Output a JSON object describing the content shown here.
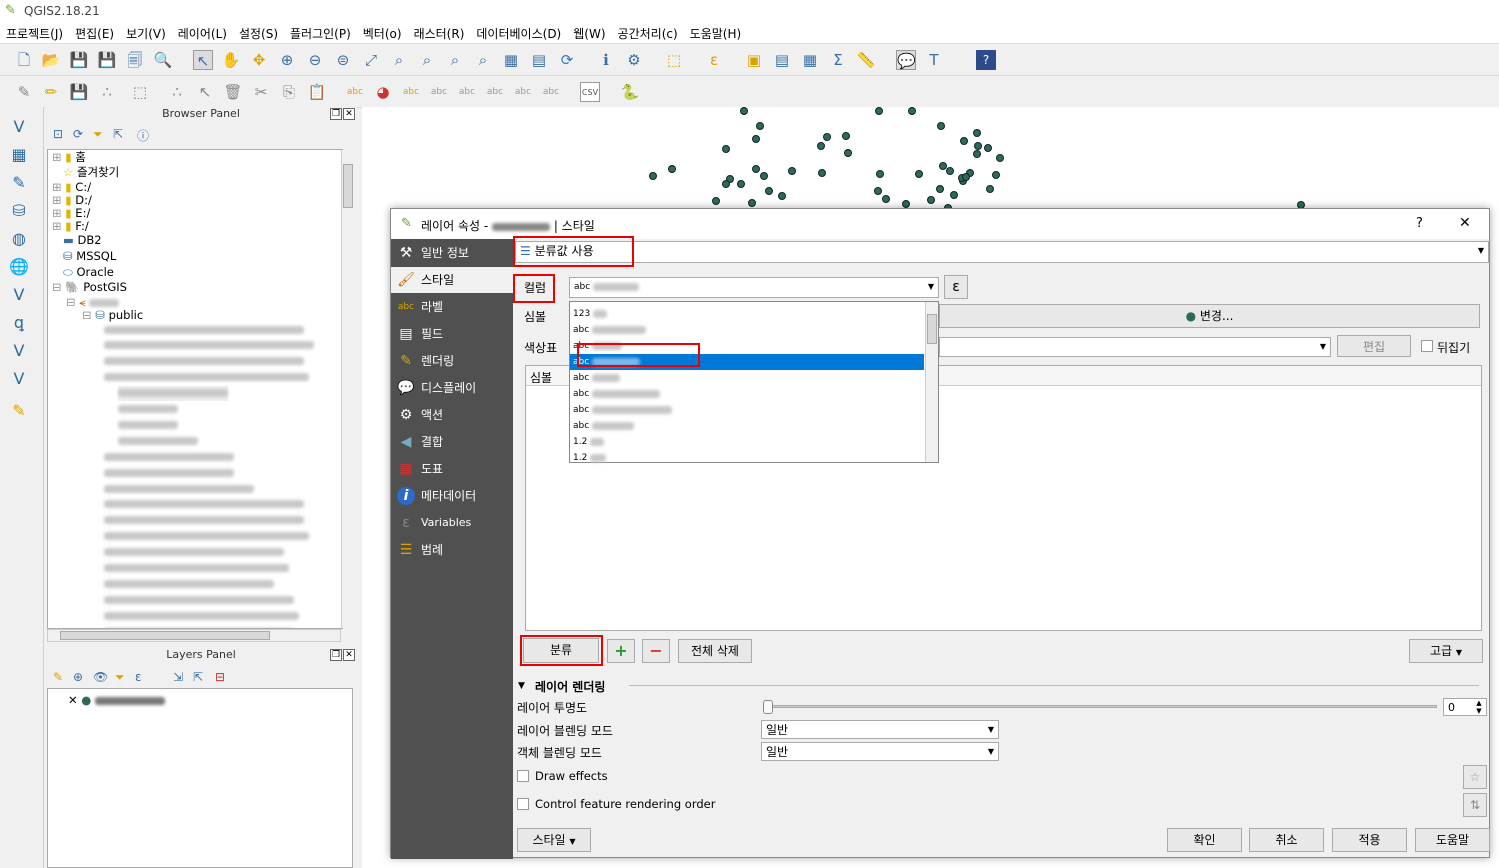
{
  "app": {
    "title": "QGIS2.18.21"
  },
  "menu": [
    "프로젝트(J)",
    "편집(E)",
    "보기(V)",
    "레이어(L)",
    "설정(S)",
    "플러그인(P)",
    "벡터(o)",
    "래스터(R)",
    "데이터베이스(D)",
    "웹(W)",
    "공간처리(c)",
    "도움말(H)"
  ],
  "browser": {
    "title": "Browser Panel",
    "items": [
      {
        "label": "홈",
        "icon": "folder-icon"
      },
      {
        "label": "즐겨찾기",
        "icon": "star-icon"
      },
      {
        "label": "C:/",
        "icon": "folder-icon"
      },
      {
        "label": "D:/",
        "icon": "folder-icon"
      },
      {
        "label": "E:/",
        "icon": "folder-icon"
      },
      {
        "label": "F:/",
        "icon": "folder-icon"
      },
      {
        "label": "DB2",
        "icon": "db2-icon"
      },
      {
        "label": "MSSQL",
        "icon": "mssql-icon"
      },
      {
        "label": "Oracle",
        "icon": "oracle-icon"
      },
      {
        "label": "PostGIS",
        "icon": "elephant-icon"
      },
      {
        "label": "public",
        "icon": "schema-icon"
      }
    ]
  },
  "layers": {
    "title": "Layers Panel"
  },
  "dialog": {
    "title": "레이어 속성 - ",
    "title_suffix": "| 스타일",
    "help": "?",
    "close": "✕",
    "sidebar": [
      {
        "label": "일반 정보",
        "icon": "tools-icon"
      },
      {
        "label": "스타일",
        "icon": "brush-icon"
      },
      {
        "label": "라벨",
        "icon": "abc-label-icon"
      },
      {
        "label": "필드",
        "icon": "table-icon"
      },
      {
        "label": "렌더링",
        "icon": "paintbrush-icon"
      },
      {
        "label": "디스플레이",
        "icon": "speech-bubble-icon"
      },
      {
        "label": "액션",
        "icon": "gear-icon"
      },
      {
        "label": "결합",
        "icon": "join-icon"
      },
      {
        "label": "도표",
        "icon": "diagram-icon"
      },
      {
        "label": "메타데이터",
        "icon": "info-icon"
      },
      {
        "label": "Variables",
        "icon": "variables-icon"
      },
      {
        "label": "범례",
        "icon": "legend-icon"
      }
    ],
    "renderer": "분류값 사용",
    "column_label": "컬럼",
    "column_value": "abc",
    "expression_btn": "ε",
    "symbol_label": "심볼",
    "change_btn": "변경...",
    "colorramp_label": "색상표",
    "edit_btn": "편집",
    "invert_label": "뒤집기",
    "table_header": "심볼",
    "dropdown_types": [
      "123",
      "abc",
      "abc",
      "abc",
      "abc",
      "abc",
      "abc",
      "abc",
      "1.2",
      "1.2"
    ],
    "classify_btn": "분류",
    "add_btn": "+",
    "remove_btn": "−",
    "delete_all_btn": "전체 삭제",
    "advanced_btn": "고급",
    "layer_rendering": "레이어 렌더링",
    "opacity_label": "레이어 투명도",
    "opacity_value": "0",
    "layer_blend_label": "레이어 블렌딩 모드",
    "layer_blend_value": "일반",
    "feature_blend_label": "객체 블렌딩 모드",
    "feature_blend_value": "일반",
    "draw_effects": "Draw effects",
    "control_order": "Control feature rendering order",
    "style_btn": "스타일",
    "ok_btn": "확인",
    "cancel_btn": "취소",
    "apply_btn": "적용",
    "help_btn": "도움말"
  }
}
